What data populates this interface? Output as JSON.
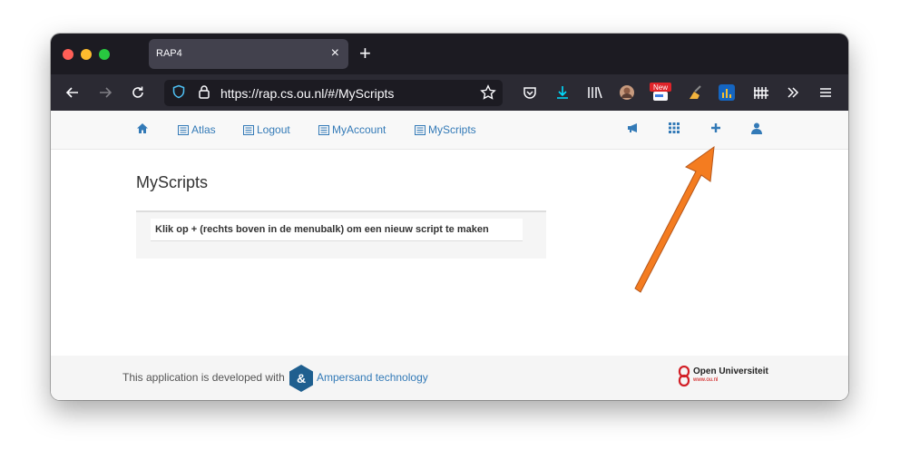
{
  "browser": {
    "tab_title": "RAP4",
    "tab_close": "×",
    "new_tab": "+",
    "url": "https://rap.cs.ou.nl/#/MyScripts",
    "toolbar_badge": "New",
    "colors": {
      "frame": "#1c1b22",
      "toolbar": "#2b2a33",
      "tab": "#42414d",
      "download": "#00ddff"
    },
    "icons": [
      "back-icon",
      "forward-icon",
      "reload-icon",
      "shield-icon",
      "lock-icon",
      "star-icon",
      "pocket-icon",
      "download-icon",
      "library-icon",
      "avatar-icon",
      "extension-new-icon",
      "broom-icon",
      "chart-icon",
      "fence-icon",
      "overflow-icon",
      "menu-icon"
    ]
  },
  "appnav": {
    "home_icon": "home-icon",
    "links": [
      {
        "label": "Atlas"
      },
      {
        "label": "Logout"
      },
      {
        "label": "MyAccount"
      },
      {
        "label": "MyScripts"
      }
    ],
    "right_icons": [
      "megaphone-icon",
      "grid-icon",
      "plus-icon",
      "user-icon"
    ],
    "link_color": "#337ab7"
  },
  "main": {
    "title": "MyScripts",
    "notice": "Klik op + (rechts boven in de menubalk) om een nieuw script te maken"
  },
  "footer": {
    "text": "This application is developed with",
    "ampersand_glyph": "&",
    "link": "Ampersand technology",
    "ou_name": "Open Universiteit",
    "ou_url": "www.ou.nl"
  },
  "annotation": {
    "arrow_color": "#f47c20"
  }
}
